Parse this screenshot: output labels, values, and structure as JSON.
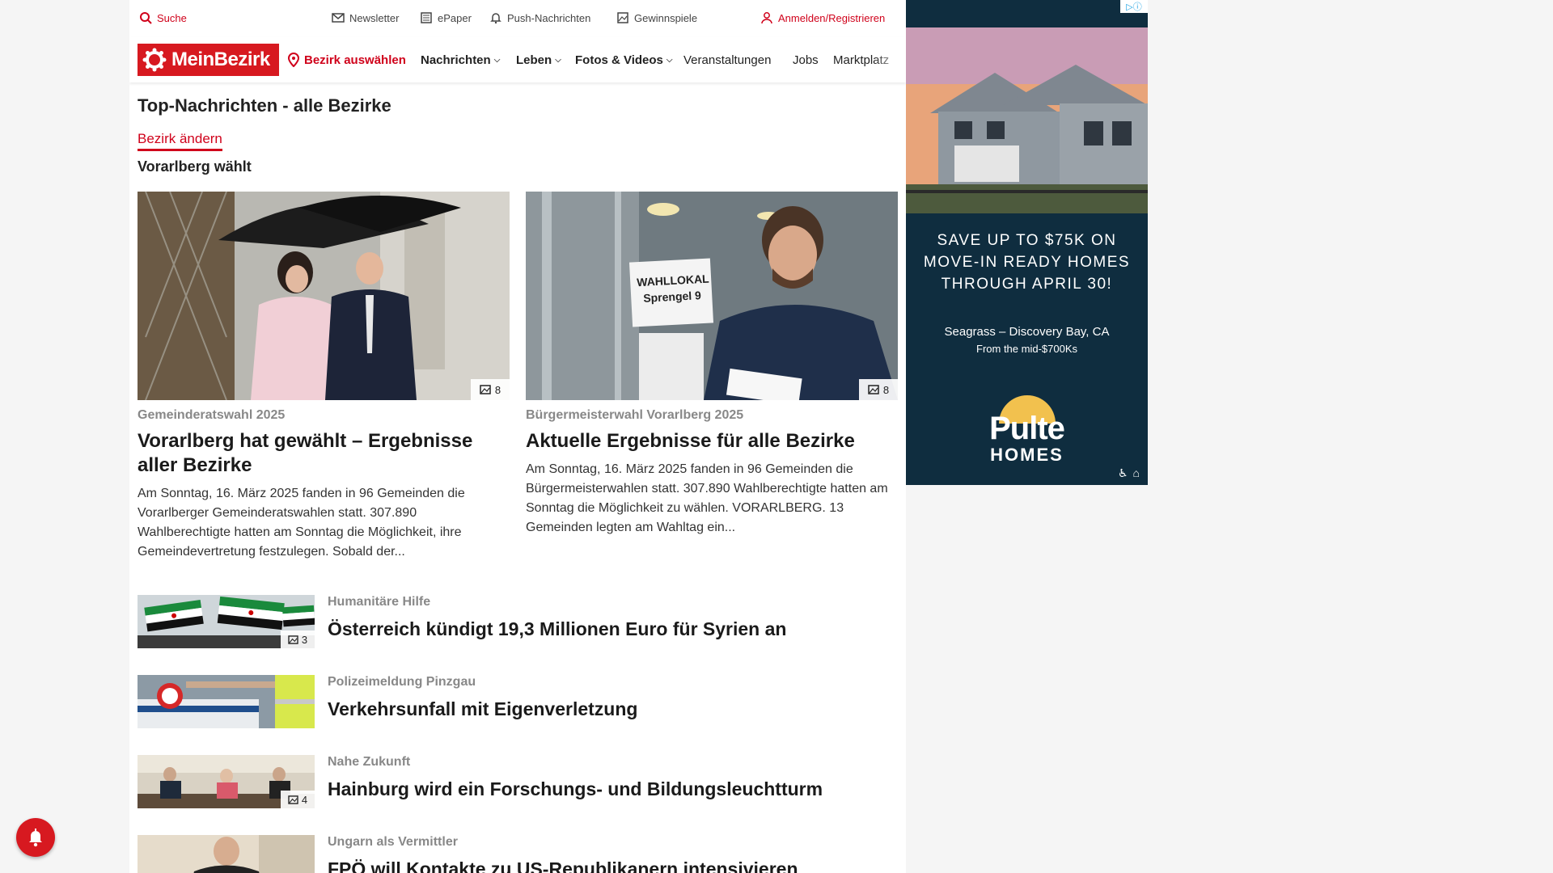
{
  "topbar": {
    "search": "Suche",
    "newsletter": "Newsletter",
    "epaper": "ePaper",
    "push": "Push-Nachrichten",
    "gewinnspiele": "Gewinnspiele",
    "login": "Anmelden/Registrieren"
  },
  "nav": {
    "logo": "MeinBezirk",
    "bezirk": "Bezirk auswählen",
    "items": [
      "Nachrichten",
      "Leben",
      "Fotos & Videos",
      "Veranstaltungen",
      "Jobs",
      "Marktplatz"
    ]
  },
  "page": {
    "title": "Top-Nachrichten - alle Bezirke",
    "change_link": "Bezirk ändern",
    "section": "Vorarlberg wählt"
  },
  "featured": [
    {
      "kicker": "Gemeinderatswahl 2025",
      "headline": "Vorarlberg hat gewählt – Ergebnisse aller Bezirke",
      "teaser": "Am Sonntag, 16. März 2025 fanden in 96 Gemeinden die Vorarlberger Gemeinderatswahlen statt. 307.890 Wahlberechtigte hatten am Sonntag die Möglichkeit, ihre Gemeindevertretung festzulegen. Sobald der...",
      "photo_count": "8"
    },
    {
      "kicker": "Bürgermeisterwahl Vorarlberg 2025",
      "headline": "Aktuelle Ergebnisse für alle Bezirke",
      "teaser": "Am Sonntag, 16. März 2025 fanden in 96 Gemeinden die Bürgermeisterwahlen statt. 307.890 Wahlberechtigte hatten am Sonntag die Möglichkeit zu wählen. VORARLBERG. 13 Gemeinden legten am Wahltag ein...",
      "photo_count": "8",
      "sign_line1": "WAHLLOKAL",
      "sign_line2": "Sprengel 9"
    }
  ],
  "list": [
    {
      "kicker": "Humanitäre Hilfe",
      "headline": "Österreich kündigt 19,3 Millionen Euro für Syrien an",
      "photo_count": "3"
    },
    {
      "kicker": "Polizeimeldung Pinzgau",
      "headline": "Verkehrsunfall mit Eigenverletzung",
      "photo_count": ""
    },
    {
      "kicker": "Nahe Zukunft",
      "headline": "Hainburg wird ein Forschungs- und Bildungsleuchtturm",
      "photo_count": "4"
    },
    {
      "kicker": "Ungarn als Vermittler",
      "headline": "FPÖ will Kontakte zu US-Republikanern intensivieren",
      "photo_count": ""
    }
  ],
  "ad": {
    "headline": "SAVE UP TO $75K ON\nMOVE-IN READY HOMES\nTHROUGH APRIL 30!",
    "location": "Seagrass – Discovery Bay, CA",
    "price": "From the mid-$700Ks",
    "brand_line1": "Pulte",
    "brand_line2": "HOMES",
    "colors": {
      "background": "#0f2d3f",
      "sky": "#e8a47a"
    }
  },
  "colors": {
    "brand_red": "#d71920",
    "link_red": "#d0021b"
  }
}
